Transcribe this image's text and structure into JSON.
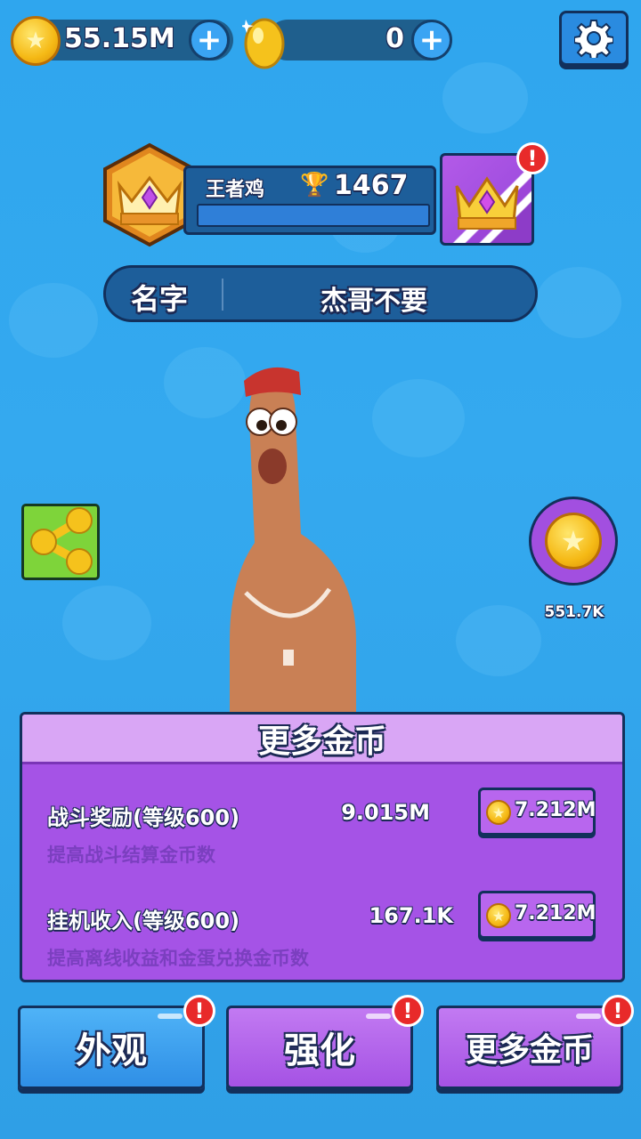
{
  "currencies": {
    "gold": {
      "value": "55.15M",
      "icon": "star-coin-icon"
    },
    "eggs": {
      "value": "0",
      "icon": "golden-egg-icon"
    }
  },
  "profile": {
    "rank_name": "王者鸡",
    "trophies": "1467",
    "name_label": "名字",
    "name_value": "杰哥不要"
  },
  "idle_coins": {
    "value": "551.7K"
  },
  "panel": {
    "title": "更多金币",
    "upgrades": [
      {
        "title": "战斗奖励(等级600)",
        "value": "9.015M",
        "desc": "提高战斗结算金币数",
        "price": "7.212M"
      },
      {
        "title": "挂机收入(等级600)",
        "value": "167.1K",
        "desc": "提高离线收益和金蛋兑换金币数",
        "price": "7.212M"
      }
    ]
  },
  "tabs": [
    {
      "label": "外观",
      "alert": "!"
    },
    {
      "label": "强化",
      "alert": "!"
    },
    {
      "label": "更多金币",
      "alert": "!"
    }
  ],
  "crown_alert": "!",
  "colors": {
    "background": "#34a9ef",
    "panel": "#a553e6",
    "panel_header": "#d9a6f5",
    "tab_blue": "#2f8fe6",
    "tab_purple": "#a552e4",
    "alert": "#e82a2a"
  }
}
